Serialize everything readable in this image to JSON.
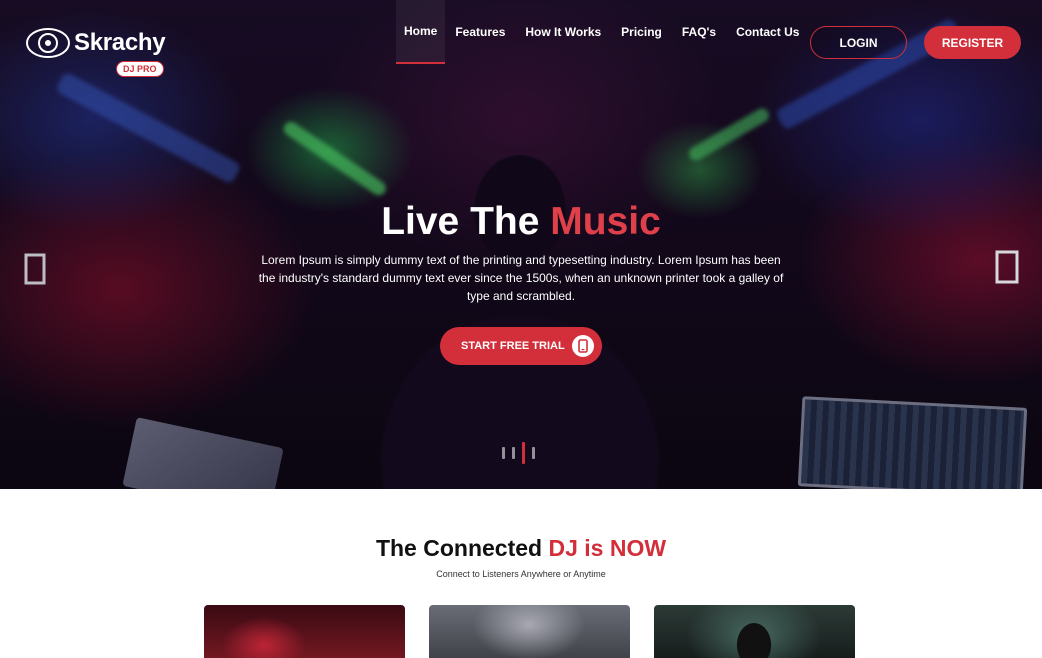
{
  "brand": {
    "name": "Skrachy",
    "badge": "DJ PRO"
  },
  "nav": {
    "items": [
      {
        "label": "Home",
        "active": true
      },
      {
        "label": "Features"
      },
      {
        "label": "How It Works"
      },
      {
        "label": "Pricing"
      },
      {
        "label": "FAQ's"
      },
      {
        "label": "Contact Us"
      }
    ],
    "login_label": "LOGIN",
    "register_label": "REGISTER"
  },
  "hero": {
    "title_main": "Live The",
    "title_accent": "Music",
    "description": "Lorem Ipsum is simply dummy text of the printing and typesetting industry. Lorem Ipsum has been the industry's standard dummy text ever since the 1500s, when an unknown printer took a galley of type and scrambled.",
    "cta_label": "START FREE TRIAL",
    "prev_icon": "chevron-left-icon",
    "next_icon": "chevron-right-icon",
    "slides": 4,
    "active_slide": 3
  },
  "section": {
    "title_main": "The Connected",
    "title_accent": "DJ is NOW",
    "subtitle": "Connect to Listeners Anywhere or Anytime"
  },
  "colors": {
    "accent": "#d32f3a",
    "white": "#ffffff",
    "heading": "#111111"
  }
}
